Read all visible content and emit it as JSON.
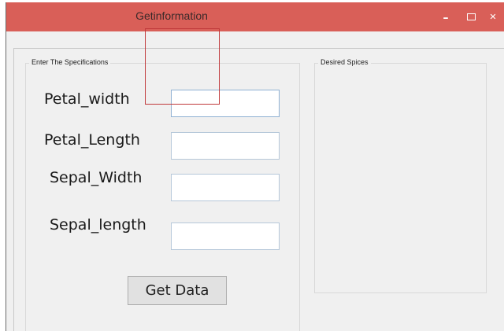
{
  "window": {
    "title": "Getinformation",
    "controls": {
      "minimize_glyph": "–",
      "close_glyph": "✕"
    },
    "colors": {
      "titlebar": "#d95f58",
      "background": "#f0f0f0"
    }
  },
  "specifications": {
    "legend": "Enter The Specifications",
    "fields": [
      {
        "label": "Petal_width",
        "value": ""
      },
      {
        "label": "Petal_Length",
        "value": ""
      },
      {
        "label": "Sepal_Width",
        "value": ""
      },
      {
        "label": "Sepal_length",
        "value": ""
      }
    ],
    "submit_label": "Get Data"
  },
  "species": {
    "legend": "Desired Spices"
  }
}
